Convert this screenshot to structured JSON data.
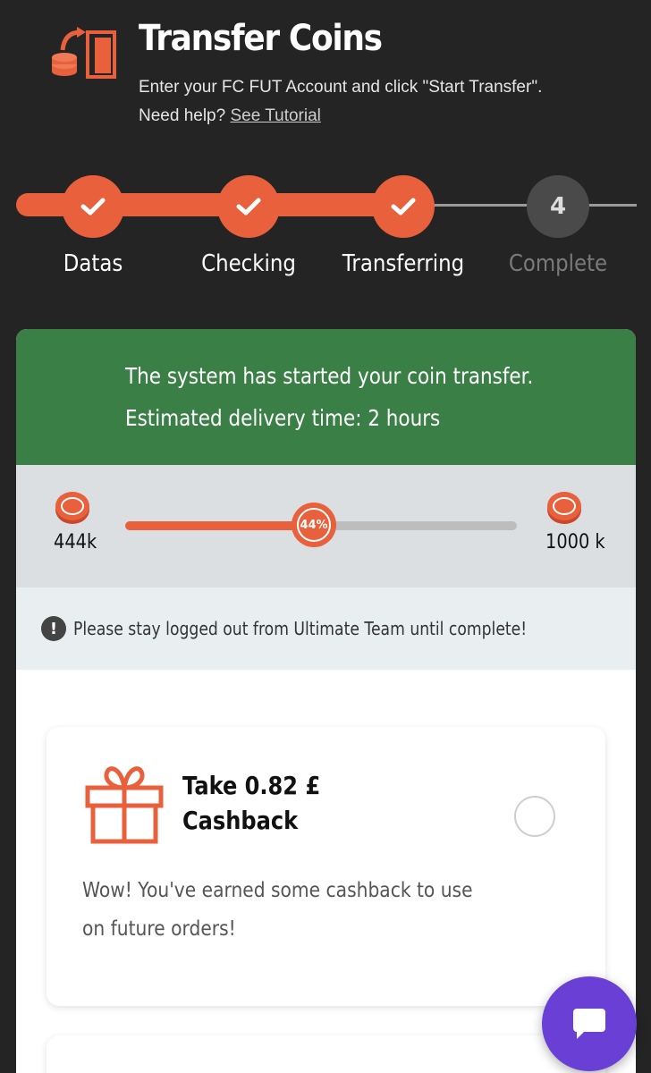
{
  "header": {
    "title": "Transfer Coins",
    "subtitle_line1": "Enter your FC FUT Account and click \"Start Transfer\".",
    "help_prefix": "Need help?",
    "tutorial_link": "See Tutorial"
  },
  "stepper": {
    "steps": [
      {
        "label": "Datas",
        "state": "done"
      },
      {
        "label": "Checking",
        "state": "done"
      },
      {
        "label": "Transferring",
        "state": "done"
      },
      {
        "label": "Complete",
        "state": "pending",
        "number": "4"
      }
    ]
  },
  "banner": {
    "line1": "The system has started your coin transfer.",
    "line2": "Estimated delivery time: 2 hours"
  },
  "progress": {
    "current_label": "444k",
    "target_label": "1000 k",
    "percent_label": "44%",
    "fraction": 0.44
  },
  "notice": {
    "text": "Please stay logged out from Ultimate Team until complete!"
  },
  "offer": {
    "title_line1": "Take 0.82 £",
    "title_line2": "Cashback",
    "description": "Wow! You've earned some cashback to use on future orders!"
  },
  "colors": {
    "accent": "#e8603c",
    "success_banner": "#3a8046",
    "chat_button": "#6a3fd6",
    "background": "#242424"
  }
}
